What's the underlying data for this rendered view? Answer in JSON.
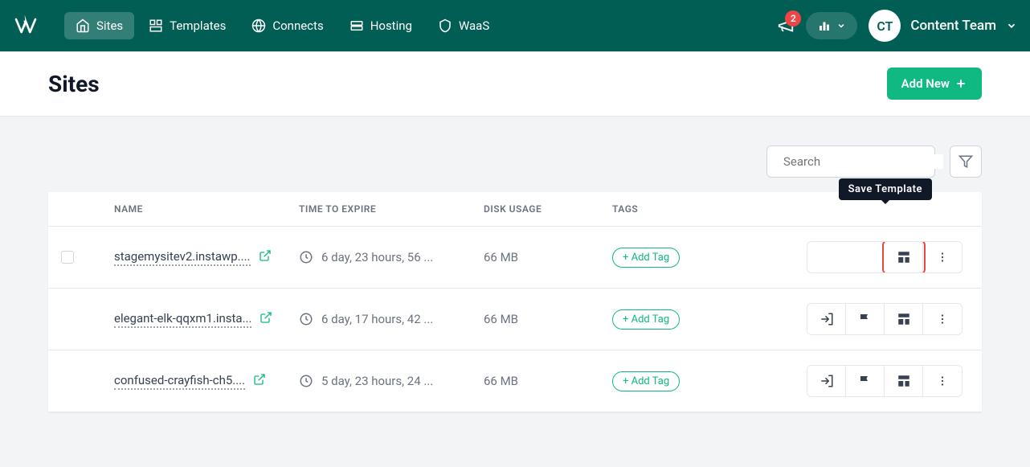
{
  "header": {
    "nav": {
      "sites": "Sites",
      "templates": "Templates",
      "connects": "Connects",
      "hosting": "Hosting",
      "waas": "WaaS"
    },
    "badge_count": "2",
    "avatar_initials": "CT",
    "team_name": "Content Team"
  },
  "page": {
    "title": "Sites",
    "add_button": "Add New"
  },
  "search": {
    "placeholder": "Search"
  },
  "tooltip": "Save Template",
  "columns": {
    "name": "NAME",
    "expire": "TIME TO EXPIRE",
    "disk": "DISK USAGE",
    "tags": "TAGS"
  },
  "add_tag_label": "+ Add Tag",
  "rows": [
    {
      "name": "stagemysitev2.instawp....",
      "expire": "6 day, 23 hours, 56 ...",
      "disk": "66 MB",
      "show_checkbox": true,
      "hide_first_actions": true,
      "highlight_template": true
    },
    {
      "name": "elegant-elk-qqxm1.insta...",
      "expire": "6 day, 17 hours, 42 ...",
      "disk": "66 MB",
      "show_checkbox": false
    },
    {
      "name": "confused-crayfish-ch5....",
      "expire": "5 day, 23 hours, 24 ...",
      "disk": "66 MB",
      "show_checkbox": false
    }
  ]
}
